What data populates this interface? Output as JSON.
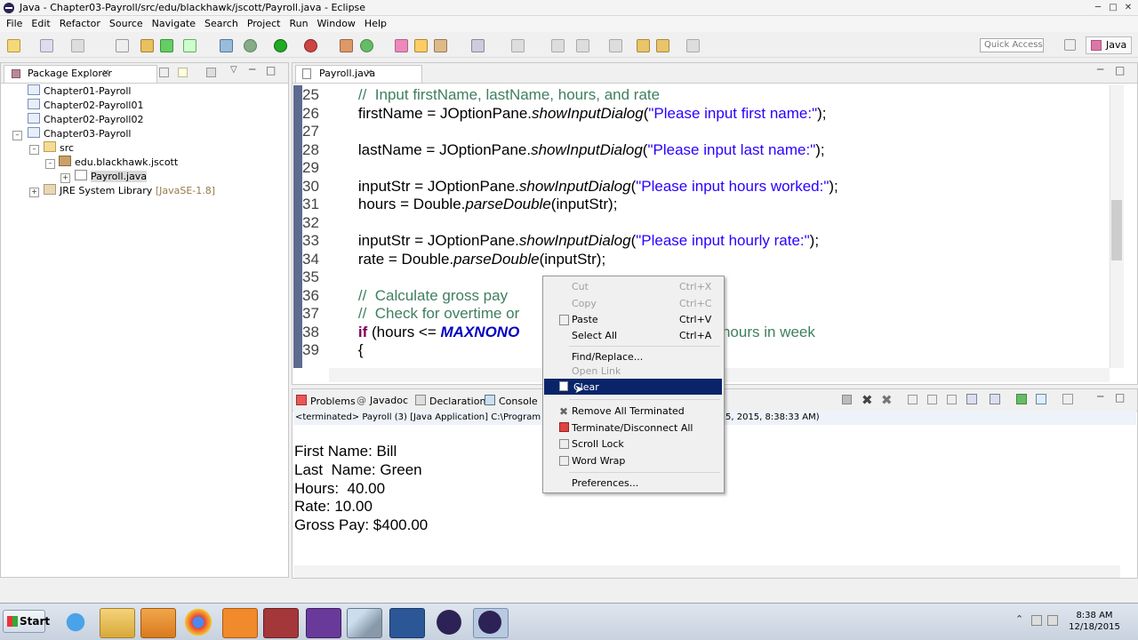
{
  "window": {
    "title": "Java - Chapter03-Payroll/src/edu/blackhawk/jscott/Payroll.java - Eclipse"
  },
  "menu": [
    "File",
    "Edit",
    "Refactor",
    "Source",
    "Navigate",
    "Search",
    "Project",
    "Run",
    "Window",
    "Help"
  ],
  "toolbar": {
    "quick_access": "Quick Access",
    "perspective": "Java"
  },
  "package_explorer": {
    "tab": "Package Explorer",
    "items": [
      {
        "label": "Chapter01-Payroll"
      },
      {
        "label": "Chapter02-Payroll01"
      },
      {
        "label": "Chapter02-Payroll02"
      },
      {
        "label": "Chapter03-Payroll"
      },
      {
        "label": "src"
      },
      {
        "label": "edu.blackhawk.jscott"
      },
      {
        "label": "Payroll.java"
      },
      {
        "label": "JRE System Library",
        "suffix": "[JavaSE-1.8]"
      }
    ]
  },
  "editor": {
    "tab": "Payroll.java",
    "lines": [
      {
        "n": "25",
        "parts": [
          {
            "t": "    //  Input firstName, lastName, hours, and rate",
            "c": "com"
          }
        ]
      },
      {
        "n": "26",
        "parts": [
          {
            "t": "    firstName = JOptionPane.",
            "c": ""
          },
          {
            "t": "showInputDialog",
            "c": "ital"
          },
          {
            "t": "(",
            "c": ""
          },
          {
            "t": "\"Please input first name:\"",
            "c": "str"
          },
          {
            "t": ");",
            "c": ""
          }
        ]
      },
      {
        "n": "27",
        "parts": []
      },
      {
        "n": "28",
        "parts": [
          {
            "t": "    lastName = JOptionPane.",
            "c": ""
          },
          {
            "t": "showInputDialog",
            "c": "ital"
          },
          {
            "t": "(",
            "c": ""
          },
          {
            "t": "\"Please input last name:\"",
            "c": "str"
          },
          {
            "t": ");",
            "c": ""
          }
        ]
      },
      {
        "n": "29",
        "parts": []
      },
      {
        "n": "30",
        "parts": [
          {
            "t": "    inputStr = JOptionPane.",
            "c": ""
          },
          {
            "t": "showInputDialog",
            "c": "ital"
          },
          {
            "t": "(",
            "c": ""
          },
          {
            "t": "\"Please input hours worked:\"",
            "c": "str"
          },
          {
            "t": ");",
            "c": ""
          }
        ]
      },
      {
        "n": "31",
        "parts": [
          {
            "t": "    hours = Double.",
            "c": ""
          },
          {
            "t": "parseDouble",
            "c": "ital"
          },
          {
            "t": "(inputStr);",
            "c": ""
          }
        ]
      },
      {
        "n": "32",
        "parts": []
      },
      {
        "n": "33",
        "parts": [
          {
            "t": "    inputStr = JOptionPane.",
            "c": ""
          },
          {
            "t": "showInputDialog",
            "c": "ital"
          },
          {
            "t": "(",
            "c": ""
          },
          {
            "t": "\"Please input hourly rate:\"",
            "c": "str"
          },
          {
            "t": ");",
            "c": ""
          }
        ]
      },
      {
        "n": "34",
        "parts": [
          {
            "t": "    rate = Double.",
            "c": ""
          },
          {
            "t": "parseDouble",
            "c": "ital"
          },
          {
            "t": "(inputStr);",
            "c": ""
          }
        ]
      },
      {
        "n": "35",
        "parts": []
      },
      {
        "n": "36",
        "parts": [
          {
            "t": "    //  Calculate gross pay",
            "c": "com"
          }
        ]
      },
      {
        "n": "37",
        "parts": [
          {
            "t": "    //  Check for overtime or",
            "c": "com"
          }
        ]
      },
      {
        "n": "38",
        "parts": [
          {
            "t": "    ",
            "c": ""
          },
          {
            "t": "if",
            "c": "kw"
          },
          {
            "t": " (hours <= ",
            "c": ""
          },
          {
            "t": "MAXNONO",
            "c": "const"
          },
          {
            "t": "                                   d 0 - 40 hours in week",
            "c": "com"
          }
        ]
      },
      {
        "n": "39",
        "parts": [
          {
            "t": "    {",
            "c": ""
          }
        ]
      }
    ]
  },
  "console": {
    "tabs": [
      "Problems",
      "Javadoc",
      "Declaration",
      "Console"
    ],
    "terminated": "<terminated> Payroll (3) [Java Application] C:\\Program Files (",
    "terminated_tail": "5, 2015, 8:38:33 AM)",
    "output": [
      "First Name: Bill",
      "Last  Name: Green",
      "Hours:  40.00",
      "Rate: 10.00",
      "Gross Pay: $400.00"
    ]
  },
  "context_menu": {
    "items": [
      {
        "label": "Cut",
        "accel": "Ctrl+X",
        "disabled": true
      },
      {
        "label": "Copy",
        "accel": "Ctrl+C",
        "disabled": true
      },
      {
        "label": "Paste",
        "accel": "Ctrl+V",
        "disabled": false
      },
      {
        "label": "Select All",
        "accel": "Ctrl+A",
        "disabled": false
      },
      {
        "label": "Find/Replace...",
        "accel": "",
        "disabled": false
      },
      {
        "label": "Open Link",
        "accel": "",
        "disabled": true
      },
      {
        "label": "Clear",
        "accel": "",
        "disabled": false,
        "highlighted": true
      },
      {
        "label": "Remove All Terminated",
        "accel": "",
        "disabled": false
      },
      {
        "label": "Terminate/Disconnect All",
        "accel": "",
        "disabled": false
      },
      {
        "label": "Scroll Lock",
        "accel": "",
        "disabled": false
      },
      {
        "label": "Word Wrap",
        "accel": "",
        "disabled": false
      },
      {
        "label": "Preferences...",
        "accel": "",
        "disabled": false
      }
    ]
  },
  "taskbar": {
    "start": "Start",
    "time": "8:38 AM",
    "date": "12/18/2015"
  },
  "colors": {
    "gutter": "#5e6a8e",
    "highlight": "#0a246a",
    "comment": "#3f7f5f",
    "string": "#2a00ff",
    "keyword": "#7f0055",
    "constant": "#0000c0"
  }
}
